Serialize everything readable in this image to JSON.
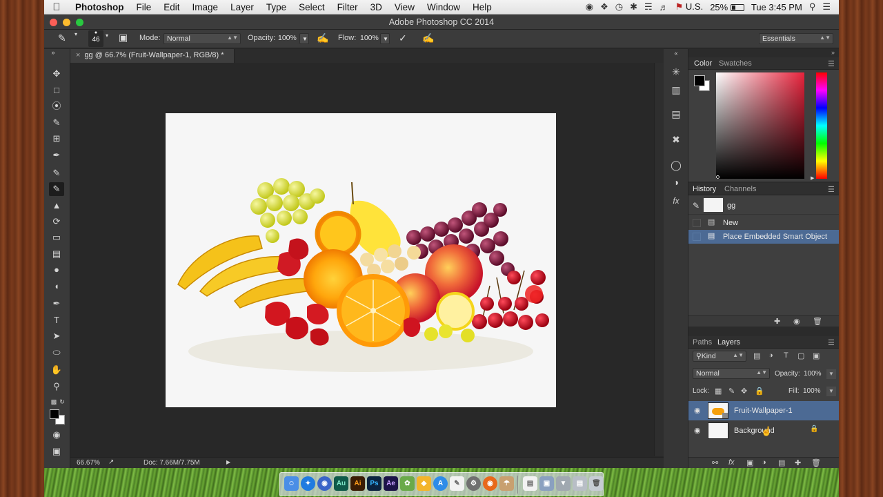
{
  "menubar": {
    "app_name": "Photoshop",
    "items": [
      "File",
      "Edit",
      "Image",
      "Layer",
      "Type",
      "Select",
      "Filter",
      "3D",
      "View",
      "Window",
      "Help"
    ],
    "input_source": "U.S.",
    "battery": "25%",
    "clock": "Tue 3:45 PM"
  },
  "window": {
    "title": "Adobe Photoshop CC 2014"
  },
  "options_bar": {
    "brush_size": "46",
    "mode_label": "Mode:",
    "mode_value": "Normal",
    "opacity_label": "Opacity:",
    "opacity_value": "100%",
    "flow_label": "Flow:",
    "flow_value": "100%",
    "workspace": "Essentials"
  },
  "document_tab": {
    "label": "gg @ 66.7% (Fruit-Wallpaper-1, RGB/8) *"
  },
  "status_bar": {
    "zoom": "66.67%",
    "doc_info": "Doc: 7.66M/7.75M"
  },
  "color_panel": {
    "tabs": [
      "Color",
      "Swatches"
    ],
    "hue_color": "#e8233c"
  },
  "history_panel": {
    "tabs": [
      "History",
      "Channels"
    ],
    "snapshot_name": "gg",
    "states": [
      "New",
      "Place Embedded Smart Object"
    ]
  },
  "layers_panel": {
    "tabs": [
      "Paths",
      "Layers"
    ],
    "filter_kind": "Kind",
    "blend_mode": "Normal",
    "opacity_label": "Opacity:",
    "opacity_value": "100%",
    "lock_label": "Lock:",
    "fill_label": "Fill:",
    "fill_value": "100%",
    "layers": [
      "Fruit-Wallpaper-1",
      "Background"
    ]
  },
  "dock": {
    "apps": [
      "Au",
      "Ai",
      "Ps",
      "Ae"
    ]
  }
}
